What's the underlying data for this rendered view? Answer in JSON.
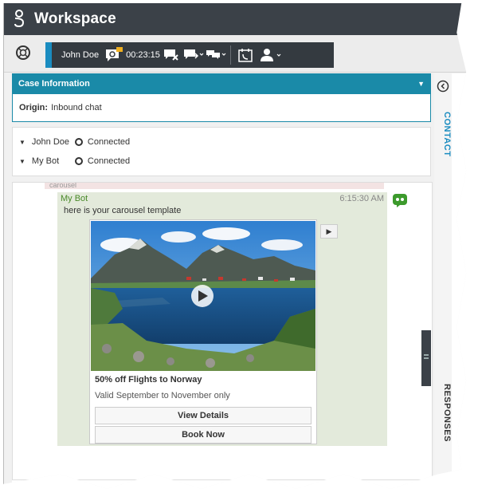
{
  "app": {
    "title": "Workspace"
  },
  "toolbar": {
    "contact_name": "John Doe",
    "timer": "00:23:15"
  },
  "case": {
    "header": "Case Information",
    "origin_label": "Origin:",
    "origin_value": "Inbound chat"
  },
  "participants": [
    {
      "name": "John Doe",
      "status": "Connected"
    },
    {
      "name": "My Bot",
      "status": "Connected"
    }
  ],
  "chat": {
    "previous_snippet": "carousel",
    "message": {
      "sender": "My Bot",
      "time": "6:15:30 AM",
      "text": "here is your carousel template"
    },
    "card": {
      "title": "50% off Flights to Norway",
      "subtitle": "Valid September to November only",
      "buttons": [
        "View Details",
        "Book Now"
      ]
    }
  },
  "side_tabs": {
    "contact": "CONTACT",
    "responses": "RESPONSES"
  },
  "colors": {
    "accent": "#1a8cc0",
    "case_header": "#1a8aa8",
    "titlebar": "#3b4148",
    "bot_bubble": "#e3eadb",
    "bot_sender": "#4a8a2a"
  }
}
